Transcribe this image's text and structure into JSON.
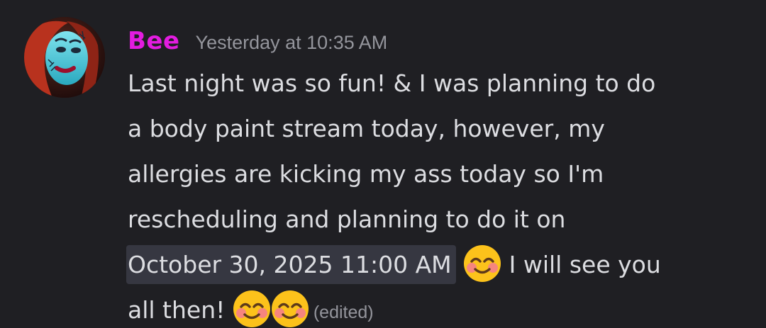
{
  "author": {
    "name": "Bee",
    "name_color": "#e31ce0"
  },
  "message": {
    "timestamp": "Yesterday at 10:35 AM",
    "lines": [
      "Last night was so fun! & I was planning to do",
      "a body paint stream today, however, my",
      "allergies are kicking my ass today so I'm",
      "rescheduling and planning to do it on"
    ],
    "scheduled_time": "October 30, 2025 11:00 AM",
    "after_time_text": " I will see you",
    "final_text": "all then! ",
    "emoji_name": "smiling-face-with-smiling-eyes-icon",
    "edited_label": "(edited)"
  },
  "colors": {
    "background": "#1f1f23",
    "text": "#dcdde1",
    "muted": "#94959c",
    "timestamp_chip": "#363741"
  }
}
